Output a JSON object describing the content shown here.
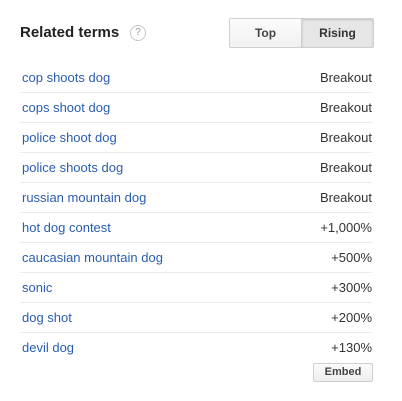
{
  "header": {
    "title": "Related terms",
    "help_icon_glyph": "?"
  },
  "toggle": {
    "options": [
      {
        "label": "Top",
        "selected": false
      },
      {
        "label": "Rising",
        "selected": true
      }
    ]
  },
  "terms": [
    {
      "term": "cop shoots dog",
      "value": "Breakout"
    },
    {
      "term": "cops shoot dog",
      "value": "Breakout"
    },
    {
      "term": "police shoot dog",
      "value": "Breakout"
    },
    {
      "term": "police shoots dog",
      "value": "Breakout"
    },
    {
      "term": "russian mountain dog",
      "value": "Breakout"
    },
    {
      "term": "hot dog contest",
      "value": "+1,000%"
    },
    {
      "term": "caucasian mountain dog",
      "value": "+500%"
    },
    {
      "term": "sonic",
      "value": "+300%"
    },
    {
      "term": "dog shot",
      "value": "+200%"
    },
    {
      "term": "devil dog",
      "value": "+130%"
    }
  ],
  "footer": {
    "embed_label": "Embed"
  },
  "colors": {
    "link": "#2a5db0",
    "text": "#222222",
    "divider": "#ebebeb"
  }
}
